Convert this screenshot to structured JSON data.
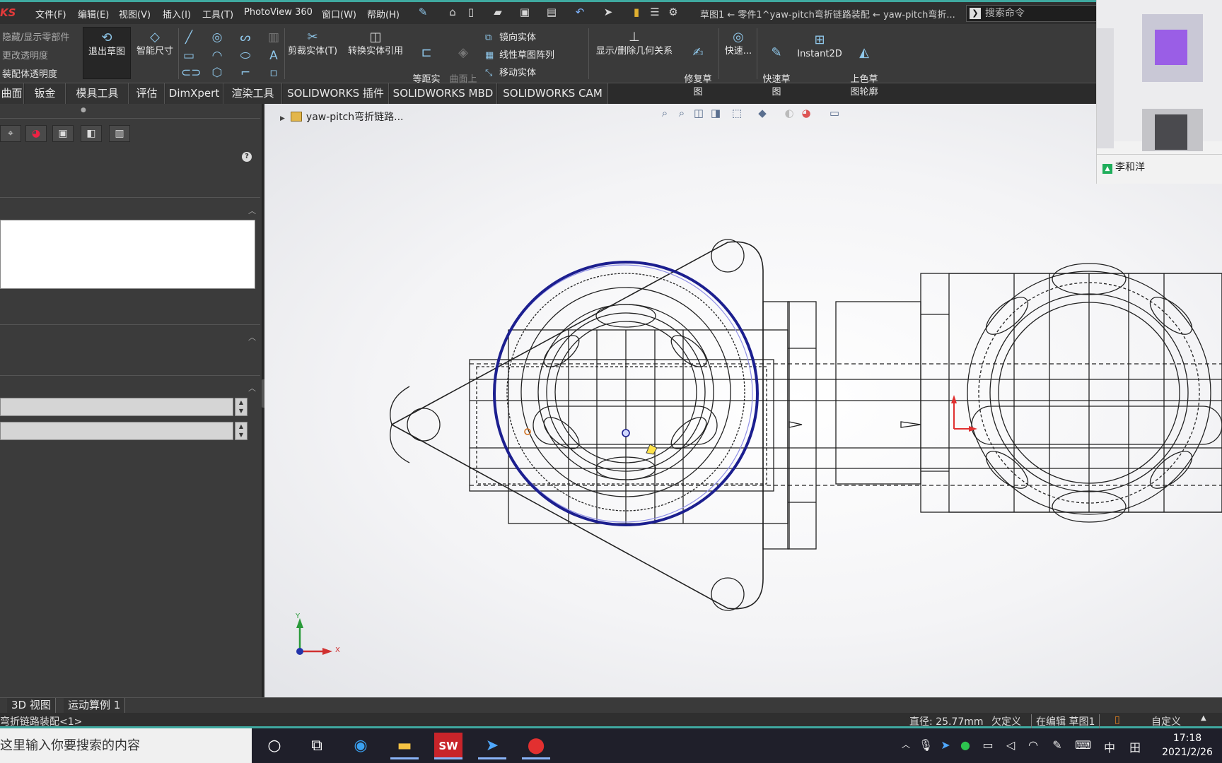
{
  "app": {
    "logo_text": "KS",
    "doc_title": "草图1 ← 零件1^yaw-pitch弯折链路装配 ← yaw-pitch弯折...",
    "accent": "#3fa9a0"
  },
  "menu": [
    "文件(F)",
    "编辑(E)",
    "视图(V)",
    "插入(I)",
    "工具(T)",
    "PhotoView 360",
    "窗口(W)",
    "帮助(H)"
  ],
  "search": {
    "placeholder": "搜索命令"
  },
  "toolbar": {
    "assembly_items": [
      "隐藏/显示零部件",
      "更改透明度",
      "装配体透明度"
    ],
    "exit_sketch": "退出草图",
    "smart_dim": "智能尺寸",
    "trim": "剪裁实体(T)",
    "convert": "转换实体引用",
    "offset": "等距实\n体",
    "surface_offset": "曲面上\n偏移",
    "mirror": "镜向实体",
    "linear_pattern": "线性草图阵列",
    "move": "移动实体",
    "relations": "显示/删除几何关系",
    "repair": "修复草\n图",
    "quick": "快速...",
    "quick_sketch": "快速草\n图",
    "instant2d": "Instant2D",
    "shaded": "上色草\n图轮廓"
  },
  "tabs": [
    "曲面",
    "钣金",
    "模具工具",
    "评估",
    "DimXpert",
    "渲染工具",
    "SOLIDWORKS 插件",
    "SOLIDWORKS MBD",
    "SOLIDWORKS CAM"
  ],
  "tree": {
    "root": "yaw-pitch弯折链路..."
  },
  "axes": {
    "y": "Y",
    "x": "X"
  },
  "bottom_tabs": [
    "3D 视图",
    "运动算例 1"
  ],
  "status": {
    "left": "弯折链路装配<1>",
    "diameter": "直径: 25.77mm",
    "state": "欠定义",
    "editing": "在编辑 草图1",
    "custom": "自定义"
  },
  "taskbar": {
    "search": "这里输入你要搜索的内容",
    "ime": "中",
    "clock_time": "17:18",
    "clock_date": "2021/2/26"
  },
  "participant": {
    "name": "李和洋"
  },
  "colors": {
    "selected_circle": "#1c1f8f",
    "construction": "#8080e0"
  }
}
